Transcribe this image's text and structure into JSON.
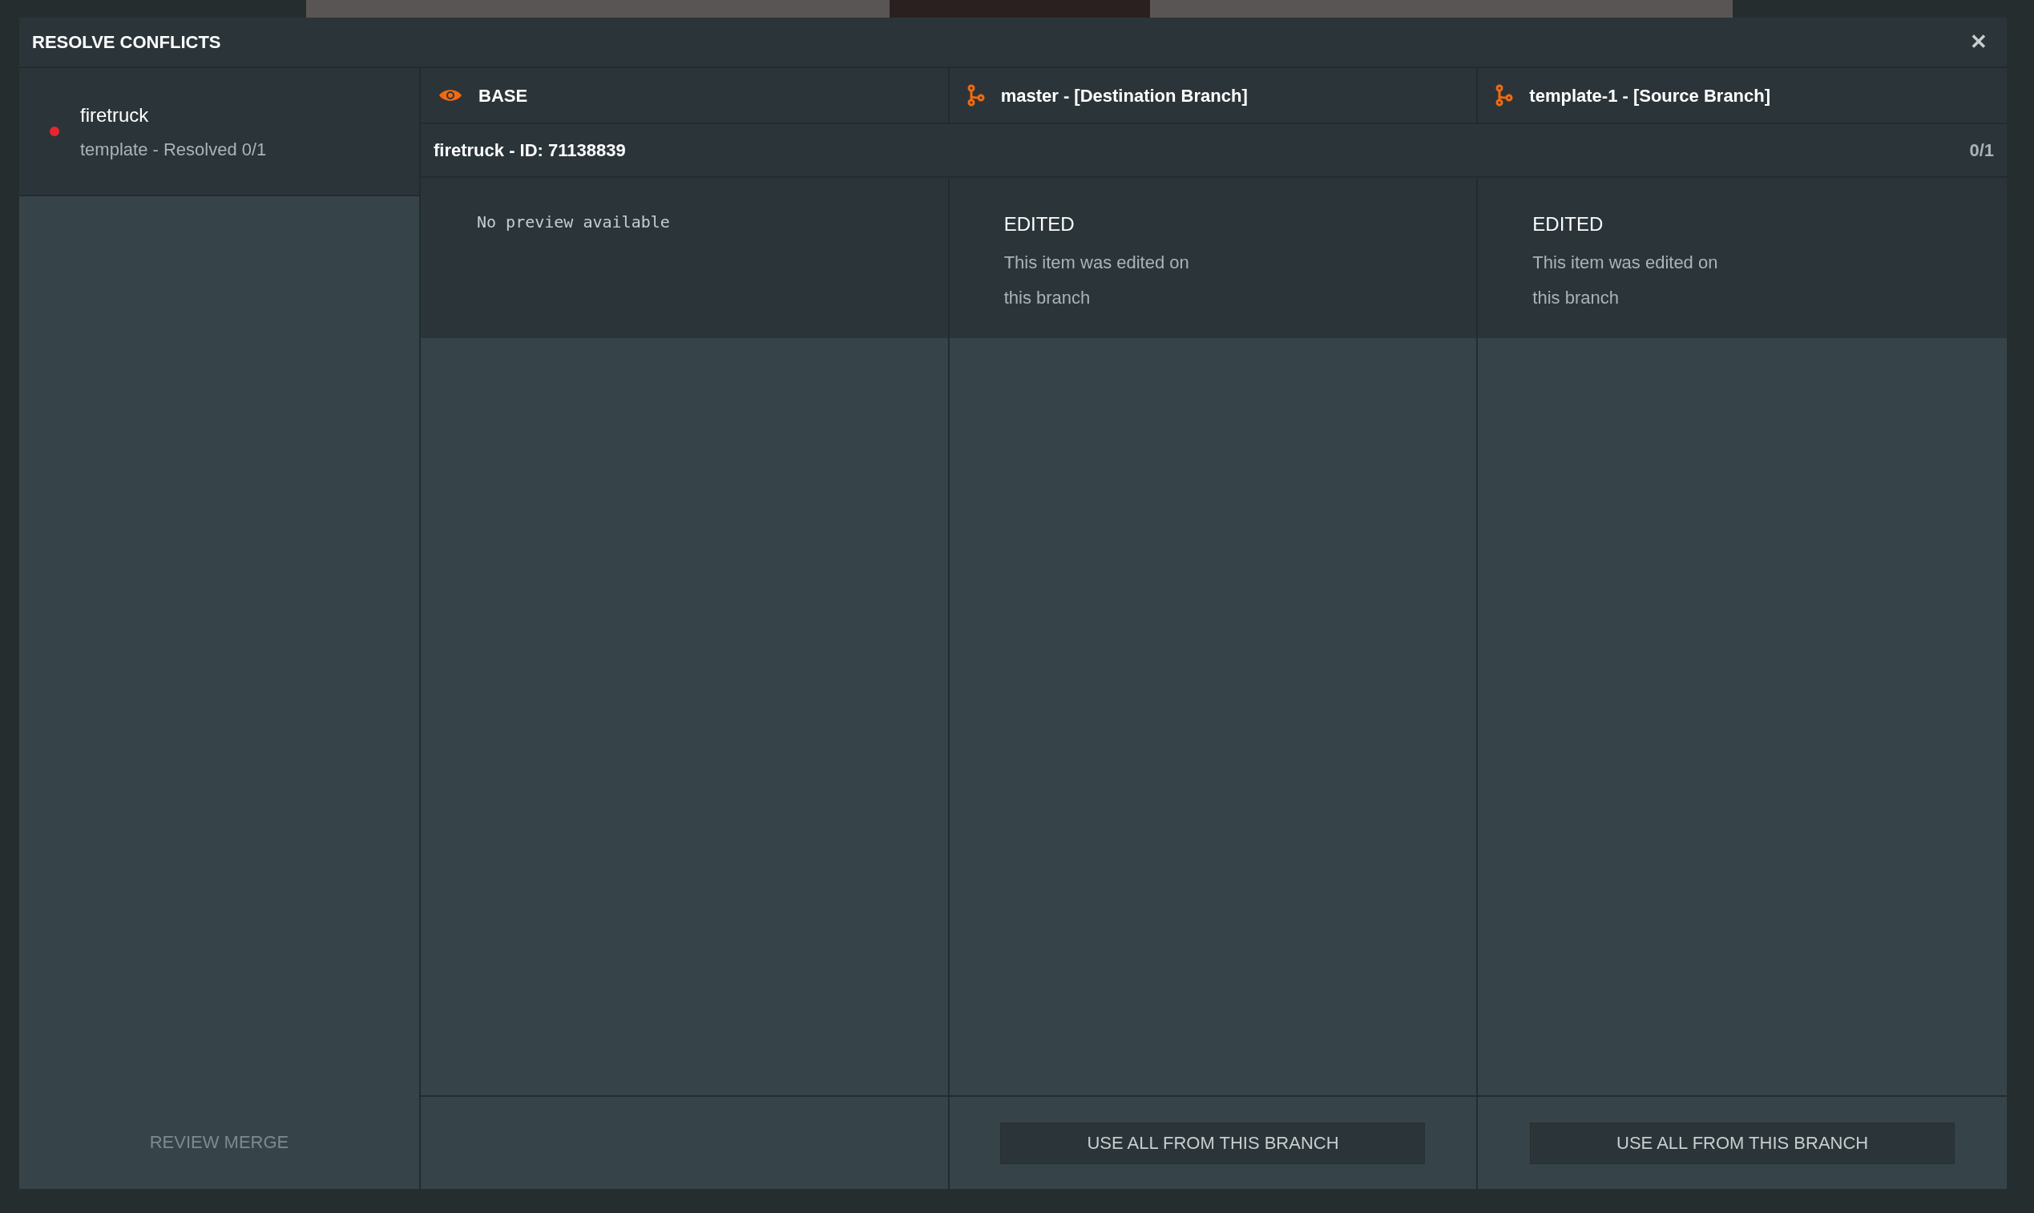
{
  "dialog": {
    "title": "RESOLVE CONFLICTS",
    "close": "✕"
  },
  "sidebar": {
    "items": [
      {
        "name": "firetruck",
        "subtitle": "template - Resolved 0/1",
        "selected": true,
        "color": "#e8252f"
      }
    ],
    "footer_button": "REVIEW MERGE"
  },
  "columns": [
    {
      "kind": "base",
      "label": "BASE"
    },
    {
      "kind": "branch",
      "label": "master - [Destination Branch]"
    },
    {
      "kind": "branch",
      "label": "template-1 - [Source Branch]"
    }
  ],
  "item_bar": {
    "title": "firetruck - ID: 71138839",
    "count": "0/1"
  },
  "cells": [
    {
      "kind": "preview",
      "text": "No preview available"
    },
    {
      "kind": "status",
      "status": "EDITED",
      "description": "This item was edited on this branch",
      "button": "USE ALL FROM THIS BRANCH"
    },
    {
      "kind": "status",
      "status": "EDITED",
      "description": "This item was edited on this branch",
      "button": "USE ALL FROM THIS BRANCH"
    }
  ]
}
